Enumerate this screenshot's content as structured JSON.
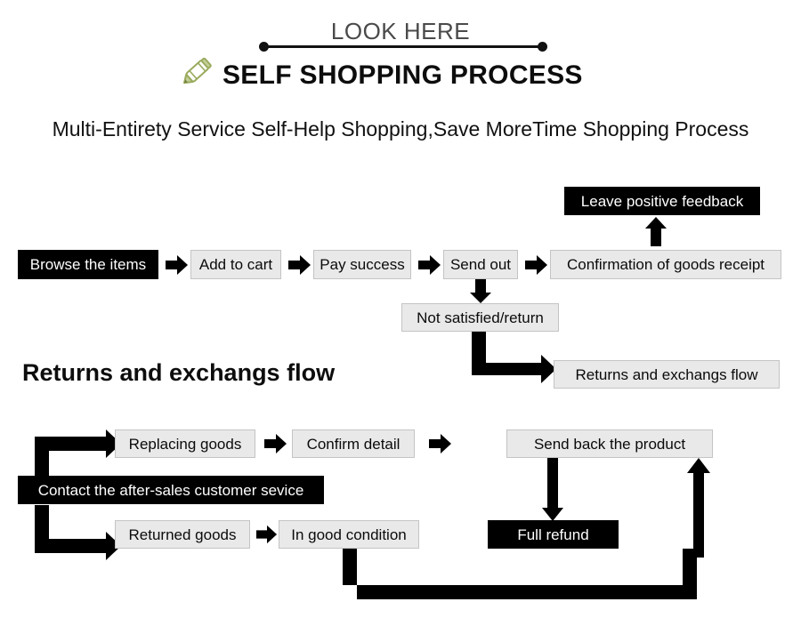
{
  "header": {
    "eyebrow": "LOOK HERE",
    "title": "SELF SHOPPING PROCESS",
    "subtitle": "Multi-Entirety Service Self-Help Shopping,Save MoreTime Shopping Process",
    "pencil_icon": "pencil-icon",
    "eyebrow_color": "#4a4a4a",
    "title_color": "#0d0d0d",
    "pencil_color": "#9aab5e"
  },
  "sections": [
    {
      "id": "main-flow",
      "heading": ""
    },
    {
      "id": "returns-flow",
      "heading": "Returns and exchangs flow"
    }
  ],
  "nodes": {
    "browse_the_items": "Browse the items",
    "add_to_cart": "Add to cart",
    "pay_success": "Pay success",
    "send_out": "Send out",
    "confirmation_of_goods_receipt": "Confirmation of goods receipt",
    "leave_positive_feedback": "Leave positive feedback",
    "not_satisfied_return": "Not satisfied/return",
    "returns_and_exchangs_flow": "Returns and exchangs flow",
    "contact_after_sales": "Contact the after-sales customer sevice",
    "replacing_goods": "Replacing goods",
    "confirm_detail": "Confirm detail",
    "send_back_the_product": "Send back the product",
    "full_refund": "Full refund",
    "returned_goods": "Returned goods",
    "in_good_condition": "In good condition"
  },
  "colors": {
    "node_light_bg": "#e9e9e9",
    "node_light_border": "#c4c4c4",
    "node_dark_bg": "#000000",
    "node_dark_text": "#ffffff",
    "arrow": "#000000",
    "page_bg": "#ffffff"
  },
  "icons": {
    "arrow_right": "arrow-right-icon",
    "arrow_down": "arrow-down-icon",
    "arrow_up": "arrow-up-icon",
    "elbow_down_right": "elbow-down-right-arrow-icon",
    "elbow_up_right": "elbow-up-right-arrow-icon",
    "loop_down_right_up": "loop-down-right-up-arrow-icon"
  }
}
